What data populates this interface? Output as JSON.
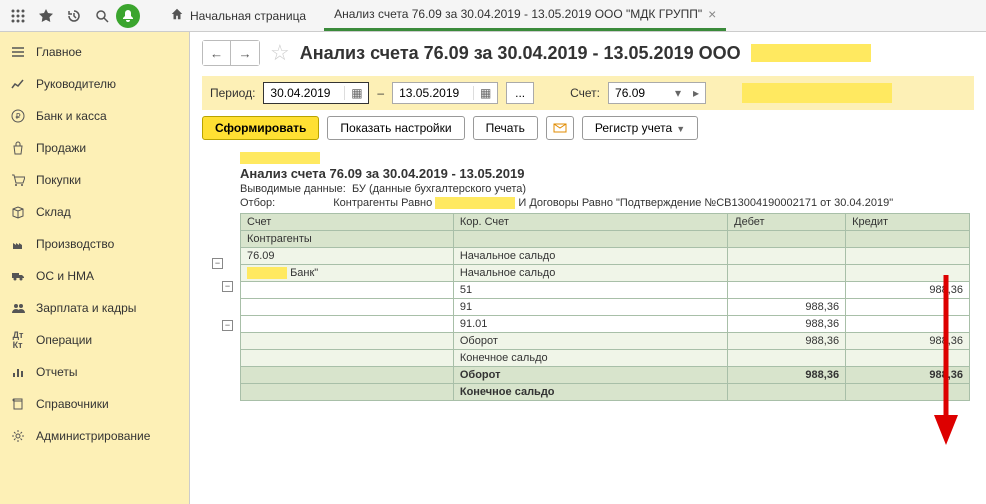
{
  "topbar": {
    "home_label": "Начальная страница",
    "tab_label": "Анализ счета 76.09 за 30.04.2019 - 13.05.2019 ООО \"МДК ГРУПП\""
  },
  "sidebar": {
    "items": [
      {
        "label": "Главное"
      },
      {
        "label": "Руководителю"
      },
      {
        "label": "Банк и касса"
      },
      {
        "label": "Продажи"
      },
      {
        "label": "Покупки"
      },
      {
        "label": "Склад"
      },
      {
        "label": "Производство"
      },
      {
        "label": "ОС и НМА"
      },
      {
        "label": "Зарплата и кадры"
      },
      {
        "label": "Операции"
      },
      {
        "label": "Отчеты"
      },
      {
        "label": "Справочники"
      },
      {
        "label": "Администрирование"
      }
    ]
  },
  "page": {
    "title": "Анализ счета 76.09 за 30.04.2019 - 13.05.2019 ООО"
  },
  "filter": {
    "period_label": "Период:",
    "date_from": "30.04.2019",
    "date_to": "13.05.2019",
    "dash": "–",
    "dots": "...",
    "account_label": "Счет:",
    "account_value": "76.09"
  },
  "actions": {
    "form": "Сформировать",
    "show_settings": "Показать настройки",
    "print": "Печать",
    "register": "Регистр учета"
  },
  "report": {
    "title": "Анализ счета 76.09 за 30.04.2019 - 13.05.2019",
    "subtitle_label": "Выводимые данные:",
    "subtitle_value": "БУ (данные бухгалтерского учета)",
    "filter_label": "Отбор:",
    "filter_value1": "Контрагенты Равно",
    "filter_value2": "И Договоры Равно \"Подтверждение №СВ13004190002171 от 30.04.2019\"",
    "headers": {
      "account": "Счет",
      "cor_account": "Кор. Счет",
      "debit": "Дебет",
      "credit": "Кредит",
      "contragents": "Контрагенты"
    },
    "rows": {
      "acct": "76.09",
      "initial_balance": "Начальное сальдо",
      "bank": "Банк\"",
      "r51": "51",
      "r91": "91",
      "r9101": "91.01",
      "turnover": "Оборот",
      "ending_balance": "Конечное сальдо",
      "v": "988,36"
    }
  }
}
